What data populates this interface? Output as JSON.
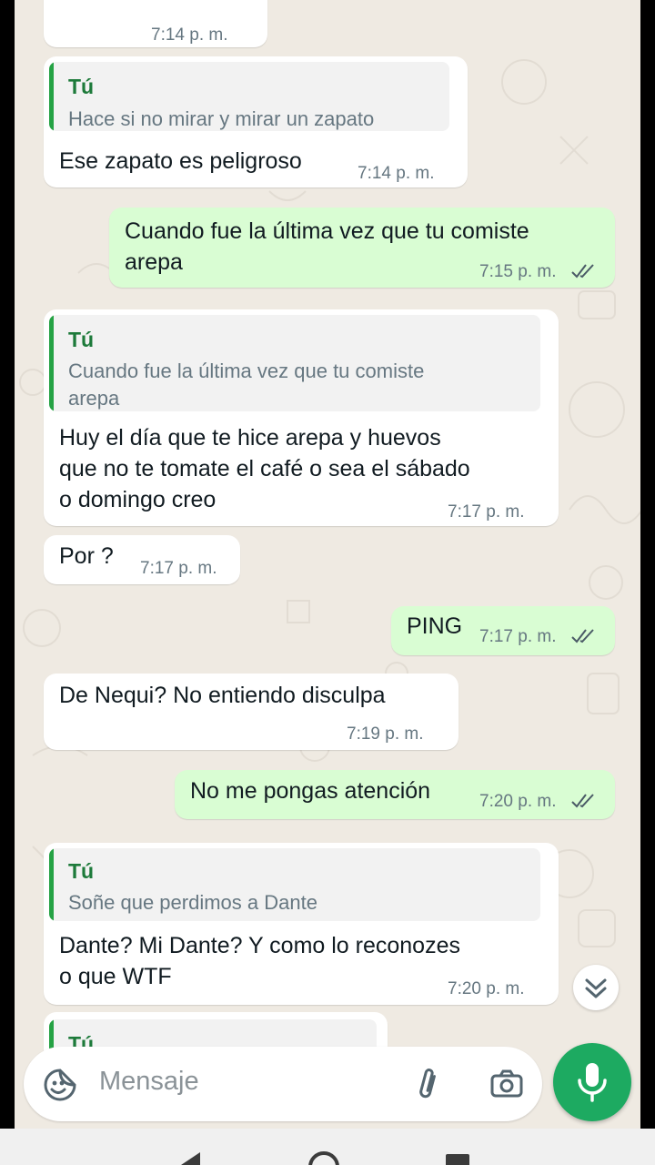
{
  "messages": [
    {
      "direction": "in",
      "text": "",
      "time": "7:14 p. m."
    },
    {
      "direction": "in",
      "reply_author": "Tú",
      "reply_text": "Hace si no mirar y mirar un zapato",
      "text": "Ese zapato es peligroso",
      "time": "7:14 p. m."
    },
    {
      "direction": "out",
      "text_lines": [
        "Cuando fue la última vez que tu comiste",
        "arepa"
      ],
      "time": "7:15 p. m.",
      "status": "read"
    },
    {
      "direction": "in",
      "reply_author": "Tú",
      "reply_text_lines": [
        "Cuando fue la última vez que tu comiste",
        "arepa"
      ],
      "text_lines": [
        "Huy el día que te hice arepa y huevos",
        "que no te tomate el café o sea el sábado",
        "o domingo creo"
      ],
      "time": "7:17 p. m."
    },
    {
      "direction": "in",
      "text": "Por ?",
      "time": "7:17 p. m."
    },
    {
      "direction": "out",
      "text": "PING",
      "time": "7:17 p. m.",
      "status": "read"
    },
    {
      "direction": "in",
      "text": "De Nequi? No entiendo disculpa",
      "time": "7:19 p. m."
    },
    {
      "direction": "out",
      "text": "No me pongas atención",
      "time": "7:20 p. m.",
      "status": "read"
    },
    {
      "direction": "in",
      "reply_author": "Tú",
      "reply_text": "Soñe que perdimos a Dante",
      "text_lines": [
        "Dante? Mi Dante? Y como lo reconozes",
        "o que WTF"
      ],
      "time": "7:20 p. m."
    },
    {
      "direction": "in",
      "reply_author": "Tú",
      "partial": true
    }
  ],
  "composer": {
    "placeholder": "Mensaje",
    "emoji_icon": "emoji-sticker-icon",
    "attach_icon": "paperclip-icon",
    "camera_icon": "camera-icon",
    "mic_icon": "microphone-icon"
  },
  "scroll_down_icon": "double-chevron-down-icon",
  "colors": {
    "wallpaper": "#efeae2",
    "incoming_bubble": "#ffffff",
    "outgoing_bubble": "#d9fdd3",
    "quote_bar": "#25a244",
    "quote_author": "#1d7a3a",
    "read_ticks": "#53bdeb",
    "mic_button": "#1daa61"
  }
}
